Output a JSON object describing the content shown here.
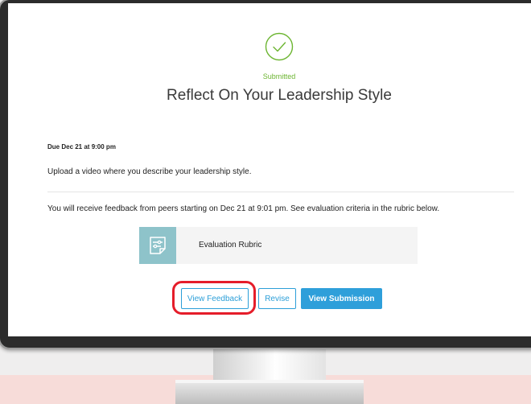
{
  "status": {
    "label": "Submitted",
    "icon": "checkmark-circle-icon",
    "color": "#6cb531"
  },
  "assignment": {
    "title": "Reflect On Your Leadership Style",
    "due": "Due Dec 21 at 9:00 pm",
    "instruction": "Upload a video where you describe your leadership style.",
    "feedback_info": "You will receive feedback from peers starting on Dec 21 at 9:01 pm. See evaluation criteria in the rubric below."
  },
  "rubric": {
    "label": "Evaluation Rubric",
    "icon": "rubric-document-icon",
    "icon_bg": "#8ec3ca"
  },
  "actions": {
    "view_feedback": "View Feedback",
    "revise": "Revise",
    "view_submission": "View Submission",
    "accent": "#2e9fda",
    "highlight": "#e51d2a"
  }
}
